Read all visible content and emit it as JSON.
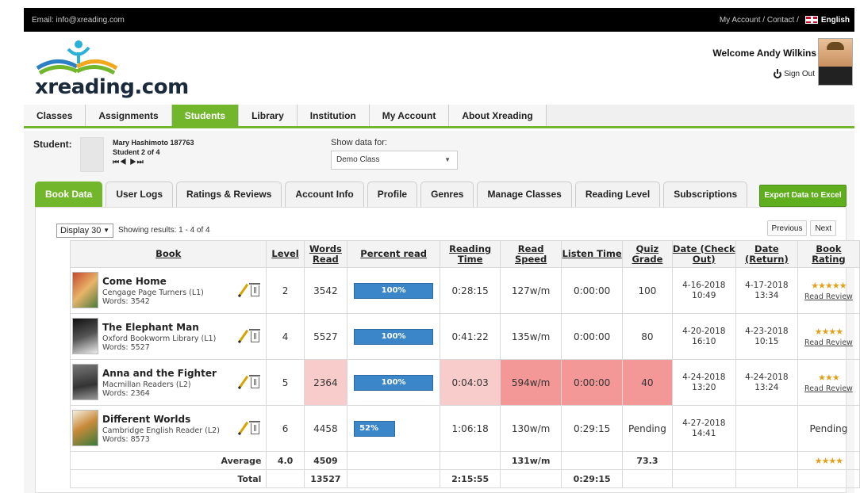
{
  "topbar": {
    "email": "Email: info@xreading.com",
    "links": "My Account / Contact /",
    "language": "English"
  },
  "header": {
    "logo_text": "xreading.com",
    "welcome": "Welcome Andy Wilkins",
    "sign_out": "Sign Out"
  },
  "nav": [
    "Classes",
    "Assignments",
    "Students",
    "Library",
    "Institution",
    "My Account",
    "About Xreading"
  ],
  "nav_active": "Students",
  "student": {
    "label": "Student:",
    "name": "Mary Hashimoto 187763",
    "position": "Student 2 of 4",
    "nav_glyphs": "⏮◀ ▶⏭"
  },
  "show_data": {
    "label": "Show data for:",
    "value": "Demo Class"
  },
  "tabs": [
    "Book Data",
    "User Logs",
    "Ratings & Reviews",
    "Account Info",
    "Profile",
    "Genres",
    "Manage Classes",
    "Reading Level",
    "Subscriptions"
  ],
  "tab_active": "Book Data",
  "export_label": "Export Data to Excel",
  "display": {
    "value": "Display 30",
    "results": "Showing results: 1 - 4 of 4"
  },
  "pager": {
    "previous": "Previous",
    "next": "Next"
  },
  "table": {
    "headers": {
      "book": "Book",
      "level": "Level",
      "words_read": "Words Read",
      "percent_read": "Percent read",
      "reading_time": "Reading Time",
      "read_speed": "Read Speed",
      "listen_time": "Listen Time",
      "quiz_grade": "Quiz Grade",
      "date_check_out": "Date (Check Out)",
      "date_return": "Date (Return)",
      "book_rating": "Book Rating"
    },
    "rows": [
      {
        "title": "Come Home",
        "series": "Cengage Page Turners (L1)",
        "words": "Words: 3542",
        "level": "2",
        "words_read": "3542",
        "percent": 100,
        "percent_label": "100%",
        "reading_time": "0:28:15",
        "read_speed": "127w/m",
        "listen_time": "0:00:00",
        "quiz_grade": "100",
        "check_out": "4-16-2018 10:49",
        "return": "4-17-2018 13:34",
        "rating": "★★★★★",
        "review": "Read Review"
      },
      {
        "title": "The Elephant Man",
        "series": "Oxford Bookworm Library (L1)",
        "words": "Words: 5527",
        "level": "4",
        "words_read": "5527",
        "percent": 100,
        "percent_label": "100%",
        "reading_time": "0:41:22",
        "read_speed": "135w/m",
        "listen_time": "0:00:00",
        "quiz_grade": "80",
        "check_out": "4-20-2018 16:10",
        "return": "4-23-2018 10:15",
        "rating": "★★★★",
        "review": "Read Review"
      },
      {
        "title": "Anna and the Fighter",
        "series": "Macmillan Readers (L2)",
        "words": "Words: 2364",
        "level": "5",
        "words_read": "2364",
        "percent": 100,
        "percent_label": "100%",
        "reading_time": "0:04:03",
        "read_speed": "594w/m",
        "listen_time": "0:00:00",
        "quiz_grade": "40",
        "check_out": "4-24-2018 13:20",
        "return": "4-24-2018 13:24",
        "rating": "★★★",
        "review": "Read Review"
      },
      {
        "title": "Different Worlds",
        "series": "Cambridge English Reader (L2)",
        "words": "Words: 8573",
        "level": "6",
        "words_read": "4458",
        "percent": 52,
        "percent_label": "52%",
        "reading_time": "1:06:18",
        "read_speed": "130w/m",
        "listen_time": "0:29:15",
        "quiz_grade": "Pending",
        "check_out": "4-27-2018 14:41",
        "return": "",
        "rating": "Pending",
        "review": ""
      }
    ],
    "average": {
      "label": "Average",
      "level": "4.0",
      "words_read": "4509",
      "read_speed": "131w/m",
      "quiz_grade": "73.3",
      "rating": "★★★★"
    },
    "total": {
      "label": "Total",
      "words_read": "13527",
      "reading_time": "2:15:55",
      "listen_time": "0:29:15"
    }
  },
  "colors": {
    "accent": "#71b62b",
    "progress": "#3b86c8",
    "warn_light": "#f9cccc",
    "warn_strong": "#f39797",
    "star": "#e3a11a"
  }
}
